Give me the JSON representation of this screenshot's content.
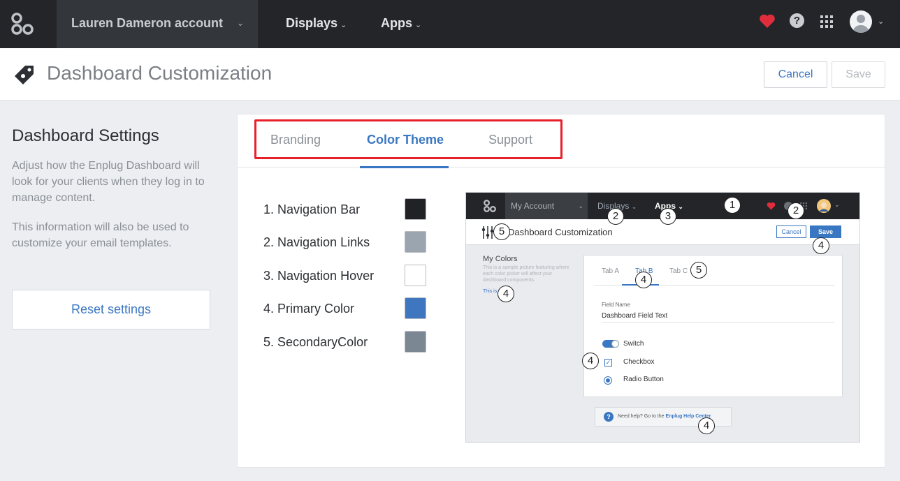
{
  "topnav": {
    "account_label": "Lauren Dameron account",
    "links": [
      {
        "label": "Displays"
      },
      {
        "label": "Apps"
      }
    ],
    "help_glyph": "?"
  },
  "header": {
    "title": "Dashboard Customization",
    "cancel_label": "Cancel",
    "save_label": "Save"
  },
  "sidebar": {
    "title": "Dashboard Settings",
    "description": "Adjust how the Enplug Dashboard will look for your clients when they log in to manage content.",
    "description2": "This information will also be used to customize your email templates.",
    "reset_label": "Reset settings"
  },
  "tabs": [
    {
      "label": "Branding",
      "active": false
    },
    {
      "label": "Color Theme",
      "active": true
    },
    {
      "label": "Support",
      "active": false
    }
  ],
  "colors": [
    {
      "label": "1.  Navigation Bar",
      "color": "#202226"
    },
    {
      "label": "2.  Navigation Links",
      "color": "#9aa5b0"
    },
    {
      "label": "3.  Navigation Hover",
      "color": "#ffffff"
    },
    {
      "label": "4.  Primary Color",
      "color": "#3f76c0"
    },
    {
      "label": "5.  SecondaryColor",
      "color": "#7b8893"
    }
  ],
  "preview": {
    "account": "My Account",
    "displays": "Displays",
    "apps": "Apps",
    "title": "Dashboard Customization",
    "cancel": "Cancel",
    "save": "Save",
    "my_colors": "My Colors",
    "my_colors_desc": "This is a sample picture featuring where each color picker will affect your dashboard components.",
    "link": "This is",
    "tabs": [
      "Tab A",
      "Tab B",
      "Tab C"
    ],
    "field_name": "Field Name",
    "field_text": "Dashboard Field Text",
    "switch": "Switch",
    "checkbox": "Checkbox",
    "radio": "Radio Button",
    "help_text": "Need help? Go to the ",
    "help_link": "Enplug Help Center",
    "markers": [
      "1",
      "2",
      "2",
      "3",
      "4",
      "4",
      "4",
      "4",
      "4",
      "5",
      "5"
    ]
  }
}
